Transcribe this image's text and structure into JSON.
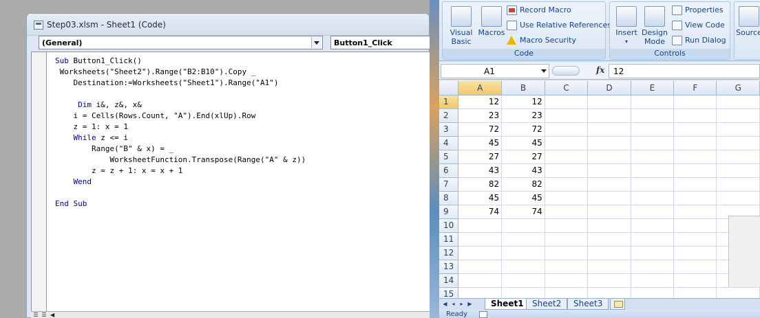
{
  "vbe": {
    "title": "Step03.xlsm - Sheet1 (Code)",
    "object_combo": "(General)",
    "proc_combo": "Button1_Click",
    "code_lines": [
      "Sub Button1_Click()",
      " Worksheets(\"Sheet2\").Range(\"B2:B10\").Copy _",
      "    Destination:=Worksheets(\"Sheet1\").Range(\"A1\")",
      "",
      "     Dim i&, z&, x&",
      "    i = Cells(Rows.Count, \"A\").End(xlUp).Row",
      "    z = 1: x = 1",
      "    While z <= i",
      "        Range(\"B\" & x) = _",
      "            WorksheetFunction.Transpose(Range(\"A\" & z))",
      "        z = z + 1: x = x + 1",
      "    Wend",
      "",
      "End Sub"
    ]
  },
  "ribbon": {
    "code_group": {
      "label": "Code",
      "visual_basic": "Visual Basic",
      "visual_basic_l1": "Visual",
      "visual_basic_l2": "Basic",
      "macros": "Macros",
      "record_macro": "Record Macro",
      "relative_refs": "Use Relative References",
      "macro_security": "Macro Security"
    },
    "controls_group": {
      "label": "Controls",
      "insert": "Insert",
      "design_mode_l1": "Design",
      "design_mode_l2": "Mode",
      "properties": "Properties",
      "view_code": "View Code",
      "run_dialog": "Run Dialog"
    },
    "source": "Source"
  },
  "formula_bar": {
    "name_box": "A1",
    "fx_label": "fx",
    "value": "12"
  },
  "sheet": {
    "columns": [
      "A",
      "B",
      "C",
      "D",
      "E",
      "F",
      "G"
    ],
    "row_numbers": [
      "1",
      "2",
      "3",
      "4",
      "5",
      "6",
      "7",
      "8",
      "9",
      "10",
      "11",
      "12",
      "13",
      "14",
      "15"
    ],
    "col_a": [
      "12",
      "23",
      "72",
      "45",
      "27",
      "43",
      "82",
      "45",
      "74"
    ],
    "col_b": [
      "12",
      "23",
      "72",
      "45",
      "27",
      "43",
      "82",
      "45",
      "74"
    ]
  },
  "tabs": [
    "Sheet1",
    "Sheet2",
    "Sheet3"
  ],
  "status": "Ready"
}
